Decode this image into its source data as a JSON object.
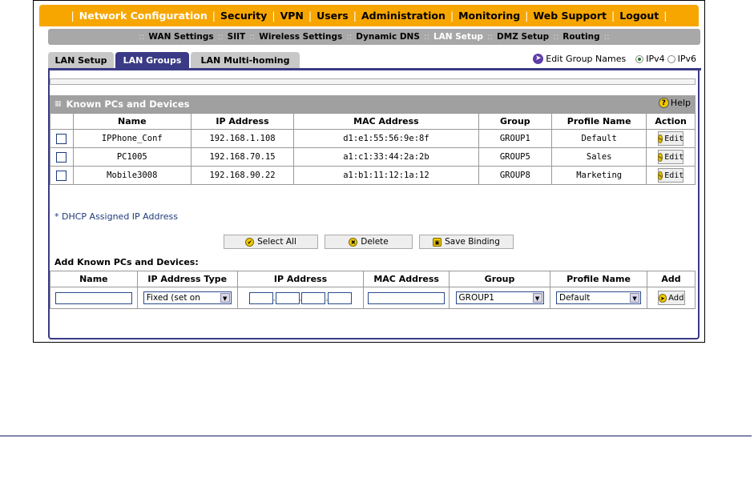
{
  "nav": {
    "items": [
      "Network Configuration",
      "Security",
      "VPN",
      "Users",
      "Administration",
      "Monitoring",
      "Web Support",
      "Logout"
    ],
    "active": "Network Configuration"
  },
  "subnav": {
    "items": [
      "WAN Settings",
      "SIIT",
      "Wireless Settings",
      "Dynamic DNS",
      "LAN Setup",
      "DMZ Setup",
      "Routing"
    ],
    "active": "LAN Setup"
  },
  "tabs": [
    {
      "label": "LAN Setup",
      "active": false
    },
    {
      "label": "LAN Groups",
      "active": true
    },
    {
      "label": "LAN Multi-homing",
      "active": false
    }
  ],
  "options": {
    "edit_group_names": "Edit Group Names",
    "ipv4": "IPv4",
    "ipv6": "IPv6",
    "selected": "IPv4"
  },
  "known": {
    "title": "Known PCs and Devices",
    "help": "Help",
    "columns": [
      "Name",
      "IP Address",
      "MAC Address",
      "Group",
      "Profile Name",
      "Action"
    ],
    "rows": [
      {
        "name": "IPPhone_Conf",
        "ip": "192.168.1.108",
        "mac": "d1:e1:55:56:9e:8f",
        "group": "GROUP1",
        "profile": "Default",
        "action": "Edit"
      },
      {
        "name": "PC1005",
        "ip": "192.168.70.15",
        "mac": "a1:c1:33:44:2a:2b",
        "group": "GROUP5",
        "profile": "Sales",
        "action": "Edit"
      },
      {
        "name": "Mobile3008",
        "ip": "192.168.90.22",
        "mac": "a1:b1:11:12:1a:12",
        "group": "GROUP8",
        "profile": "Marketing",
        "action": "Edit"
      }
    ],
    "note": "* DHCP Assigned IP Address"
  },
  "buttons": {
    "select_all": "Select All",
    "delete": "Delete",
    "save_binding": "Save Binding"
  },
  "add": {
    "title": "Add Known PCs and Devices:",
    "columns": [
      "Name",
      "IP Address Type",
      "IP Address",
      "MAC Address",
      "Group",
      "Profile Name",
      "Add"
    ],
    "ip_type_value": "Fixed (set on",
    "group_value": "GROUP1",
    "profile_value": "Default",
    "add_label": "Add"
  }
}
